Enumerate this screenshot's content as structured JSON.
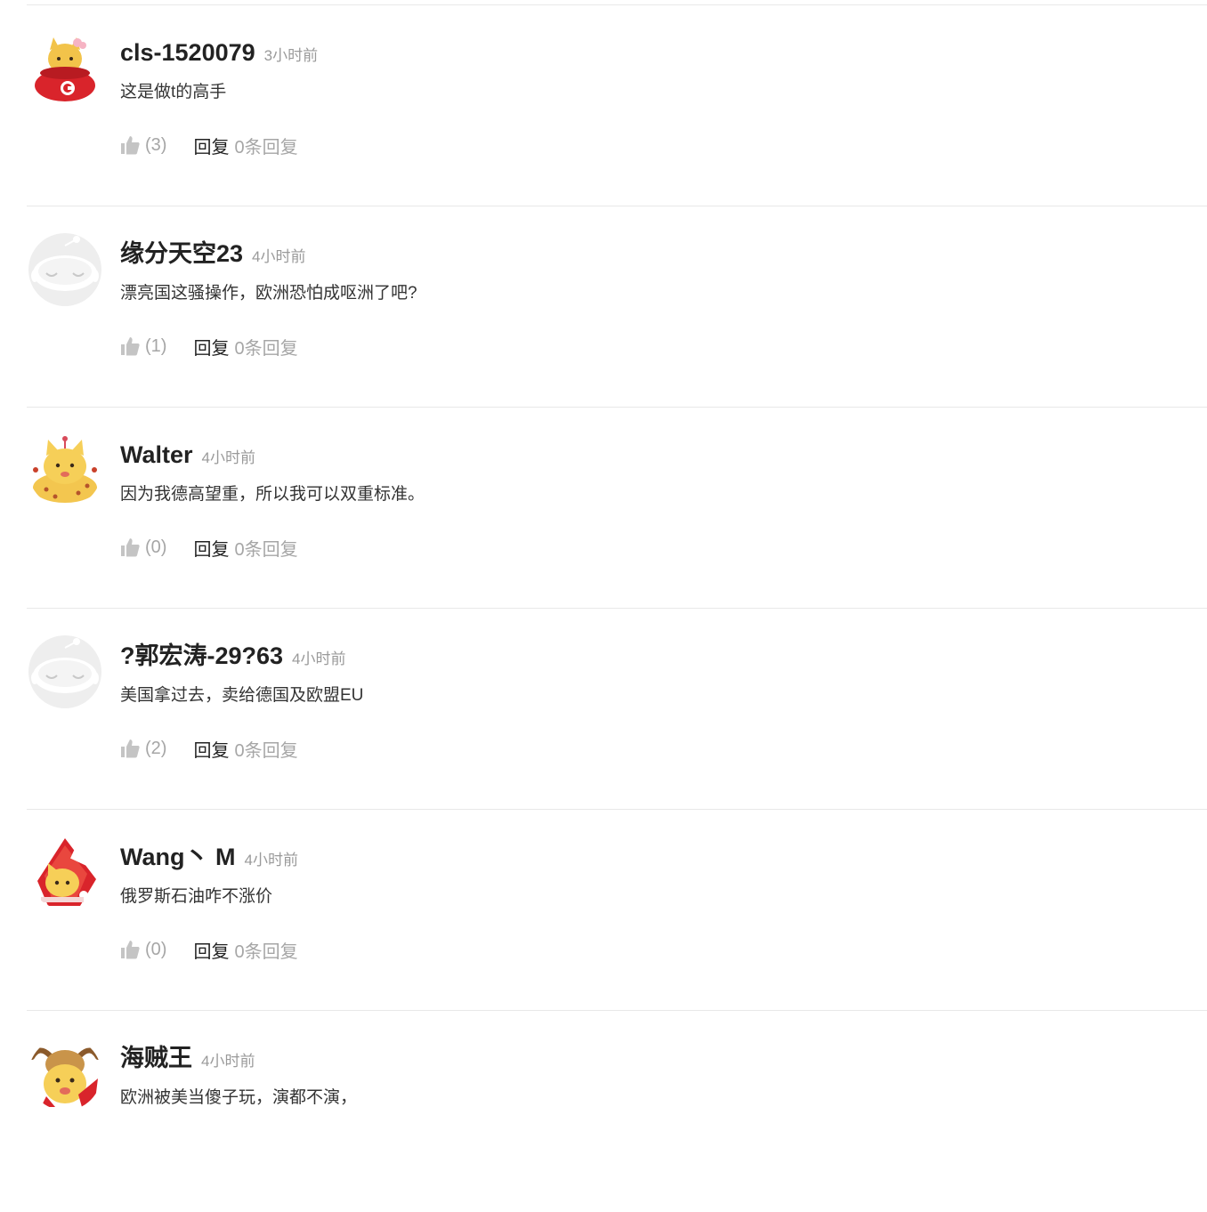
{
  "comments": [
    {
      "username": "cls-1520079",
      "time": "3小时前",
      "text": "这是做t的高手",
      "likes": "(3)",
      "reply_label": "回复",
      "reply_count": "0条回复",
      "avatar_icon": "cartoon-cat-red-scarf-avatar"
    },
    {
      "username": "缘分天空23",
      "time": "4小时前",
      "text": "漂亮国这骚操作，欧洲恐怕成呕洲了吧?",
      "likes": "(1)",
      "reply_label": "回复",
      "reply_count": "0条回复",
      "avatar_icon": "default-grey-avatar"
    },
    {
      "username": "Walter",
      "time": "4小时前",
      "text": "因为我德高望重，所以我可以双重标准。",
      "likes": "(0)",
      "reply_label": "回复",
      "reply_count": "0条回复",
      "avatar_icon": "cartoon-cat-yellow-avatar"
    },
    {
      "username": "?郭宏涛-29?63",
      "time": "4小时前",
      "text": "美国拿过去，卖给德国及欧盟EU",
      "likes": "(2)",
      "reply_label": "回复",
      "reply_count": "0条回复",
      "avatar_icon": "default-grey-avatar"
    },
    {
      "username": "Wang丶 M",
      "time": "4小时前",
      "text": "俄罗斯石油咋不涨价",
      "likes": "(0)",
      "reply_label": "回复",
      "reply_count": "0条回复",
      "avatar_icon": "cartoon-cat-red-flag-avatar"
    },
    {
      "username": "海贼王",
      "time": "4小时前",
      "text": "欧洲被美当傻子玩，演都不演，",
      "likes": "",
      "reply_label": "",
      "reply_count": "",
      "avatar_icon": "cartoon-cat-bull-avatar"
    }
  ],
  "colors": {
    "divider": "#e8e8e8",
    "username": "#222222",
    "timestamp": "#9a9a9a",
    "muted": "#a6a6a6",
    "body_text": "#333333"
  }
}
